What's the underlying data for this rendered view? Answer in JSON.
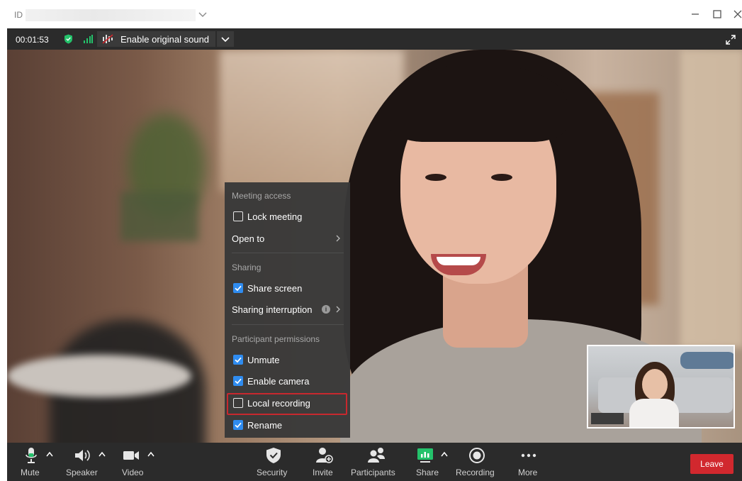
{
  "titlebar": {
    "id_label": "ID"
  },
  "status": {
    "duration": "00:01:53",
    "original_sound_label": "Enable original sound"
  },
  "security_menu": {
    "sections": [
      {
        "header": "Meeting access",
        "items": [
          {
            "label": "Lock meeting",
            "type": "checkbox",
            "checked": false
          },
          {
            "label": "Open to",
            "type": "submenu"
          }
        ]
      },
      {
        "header": "Sharing",
        "items": [
          {
            "label": "Share screen",
            "type": "checkbox",
            "checked": true
          },
          {
            "label": "Sharing interruption",
            "type": "submenu",
            "info": true
          }
        ]
      },
      {
        "header": "Participant permissions",
        "items": [
          {
            "label": "Unmute",
            "type": "checkbox",
            "checked": true
          },
          {
            "label": "Enable camera",
            "type": "checkbox",
            "checked": true
          },
          {
            "label": "Local recording",
            "type": "checkbox",
            "checked": false,
            "highlighted": true
          },
          {
            "label": "Rename",
            "type": "checkbox",
            "checked": true
          }
        ]
      }
    ]
  },
  "toolbar": {
    "left": [
      {
        "label": "Mute",
        "icon": "microphone-icon"
      },
      {
        "label": "Speaker",
        "icon": "speaker-icon"
      },
      {
        "label": "Video",
        "icon": "video-camera-icon"
      }
    ],
    "center": [
      {
        "label": "Security",
        "icon": "shield-icon"
      },
      {
        "label": "Invite",
        "icon": "add-person-icon"
      },
      {
        "label": "Participants",
        "icon": "participants-icon"
      },
      {
        "label": "Share",
        "icon": "share-screen-icon"
      },
      {
        "label": "Recording",
        "icon": "record-icon"
      },
      {
        "label": "More",
        "icon": "more-dots-icon"
      }
    ],
    "leave_label": "Leave"
  },
  "colors": {
    "accent": "#2f8cf0",
    "leave": "#d1282e",
    "highlight": "#c8282e",
    "secure_green": "#24c26b"
  }
}
